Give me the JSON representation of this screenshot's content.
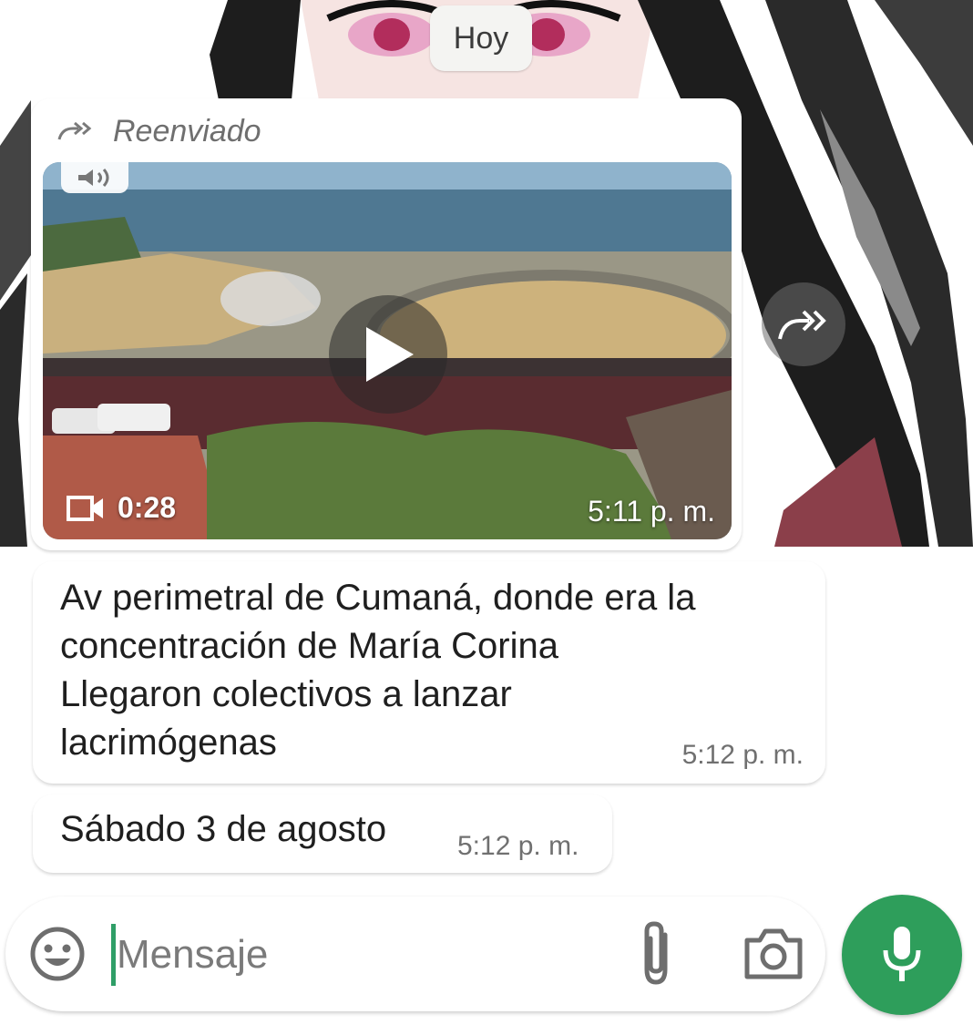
{
  "chat": {
    "date_chip": "Hoy",
    "messages": [
      {
        "type": "video",
        "forwarded_label": "Reenviado",
        "duration": "0:28",
        "time": "5:11 p. m."
      },
      {
        "type": "text",
        "text": "Av perimetral de Cumaná, donde era la\nconcentración de María Corina\nLlegaron colectivos a lanzar\nlacrimógenas",
        "time": "5:12 p. m."
      },
      {
        "type": "text",
        "text": "Sábado 3 de agosto",
        "time": "5:12 p. m."
      }
    ]
  },
  "composer": {
    "placeholder": "Mensaje",
    "value": ""
  },
  "icons": {
    "forwarded": "forwarded-icon",
    "sound": "sound-icon",
    "play": "play-icon",
    "video": "video-camera-icon",
    "forward": "forward-icon",
    "emoji": "emoji-icon",
    "attach": "paperclip-icon",
    "camera": "camera-icon",
    "mic": "microphone-icon"
  },
  "colors": {
    "accent_green": "#2e9e5b",
    "caret_green": "#2f9e67",
    "bubble": "#ffffff",
    "meta_text": "#707070"
  }
}
